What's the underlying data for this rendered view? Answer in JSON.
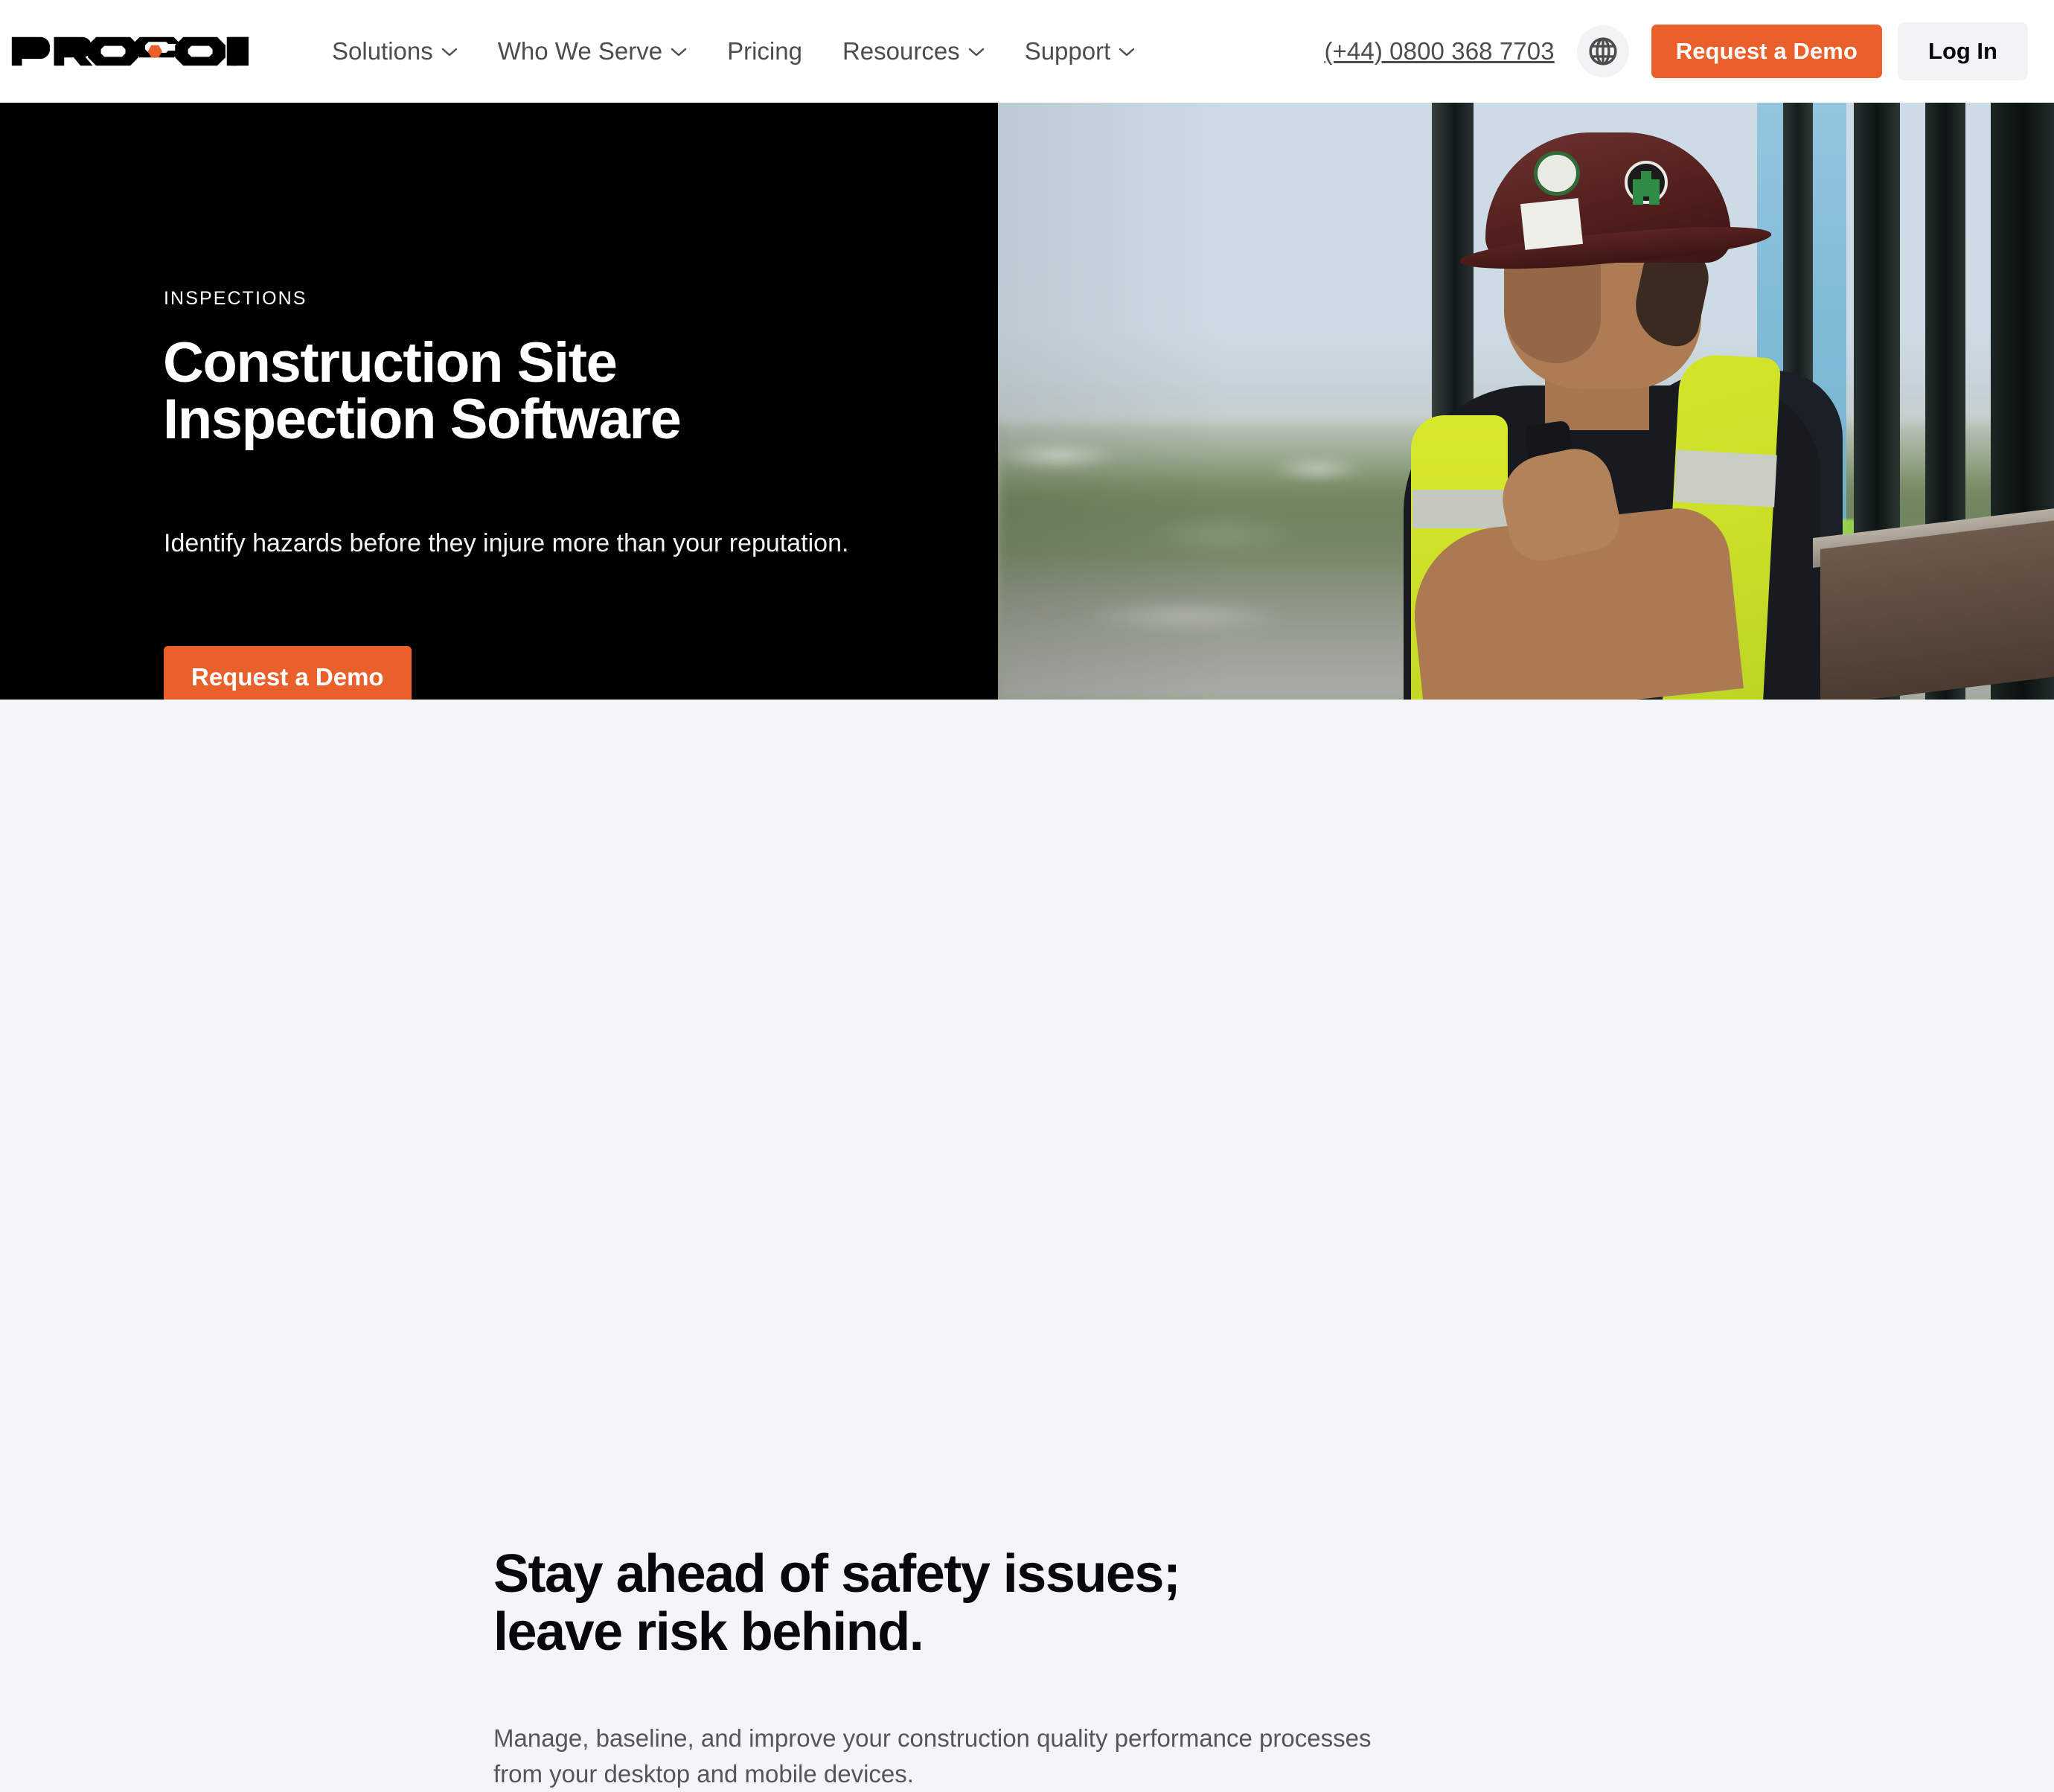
{
  "header": {
    "logo_text": "PROCORE",
    "logo_accent_color": "#e9602a",
    "nav": [
      {
        "label": "Solutions",
        "has_dropdown": true
      },
      {
        "label": "Who We Serve",
        "has_dropdown": true
      },
      {
        "label": "Pricing",
        "has_dropdown": false
      },
      {
        "label": "Resources",
        "has_dropdown": true
      },
      {
        "label": "Support",
        "has_dropdown": true
      }
    ],
    "phone": "(+44) 0800 368 7703",
    "globe_icon": "globe-icon",
    "demo_button": "Request a Demo",
    "login_button": "Log In"
  },
  "hero": {
    "eyebrow": "INSPECTIONS",
    "title_line1": "Construction Site",
    "title_line2": "Inspection Software",
    "subtitle": "Identify hazards before they injure more than your reputation.",
    "cta": "Request a Demo",
    "background_color": "#000000",
    "image_alt": "Construction worker in hard hat and high-visibility vest holding a radio, overlooking a city skyline from a high-rise"
  },
  "section": {
    "title_line1": "Stay ahead of safety issues;",
    "title_line2": "leave risk behind.",
    "body": "Manage, baseline, and improve your construction quality performance processes from your desktop and mobile devices.",
    "background_color": "#f4f5f6"
  },
  "colors": {
    "accent_orange": "#e9602a",
    "dark": "#000000",
    "text_gray": "#53565a",
    "light_gray": "#f2f3f4"
  }
}
